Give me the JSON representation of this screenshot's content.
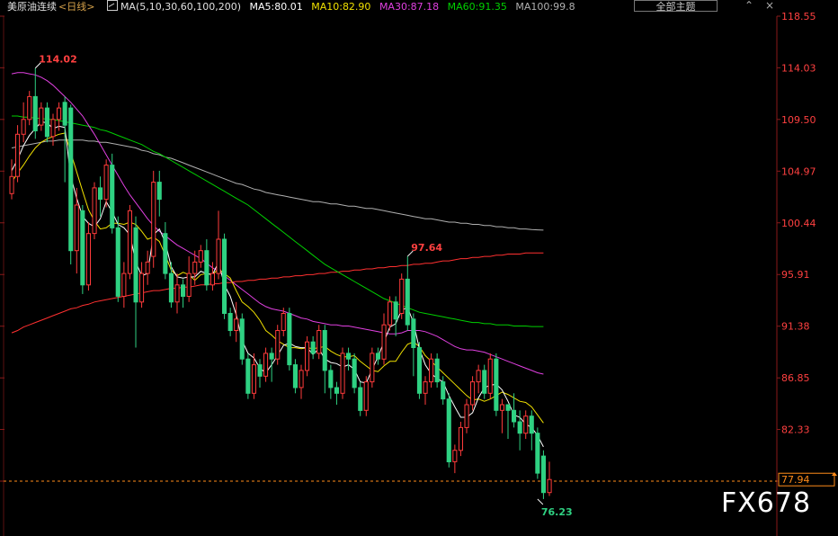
{
  "header": {
    "title": "美原油连续",
    "period": "<日线>",
    "ma_label": "MA(5,10,30,60,100,200)",
    "ma5": "MA5:80.01",
    "ma10": "MA10:82.90",
    "ma30": "MA30:87.18",
    "ma60": "MA60:91.35",
    "ma100": "MA100:99.8"
  },
  "toolbar": {
    "theme_button": "全部主题",
    "icons": [
      "chevron-up-icon",
      "cross-icon"
    ]
  },
  "watermark": "FX678",
  "colors": {
    "background": "#000000",
    "up": "#ff3b3b",
    "down": "#2fd182",
    "ma5": "#ffffff",
    "ma10": "#f0e000",
    "ma30": "#e040e0",
    "ma60": "#00d000",
    "ma100": "#b0b0b0",
    "ma200": "#ff3030",
    "axis_text": "#ff4040",
    "grid": "#5a1010",
    "current_line": "#ff8c1a"
  },
  "chart_data": {
    "type": "candlestick",
    "y_ticks": [
      118.55,
      114.03,
      109.5,
      104.97,
      100.44,
      95.91,
      91.38,
      86.85,
      82.33,
      77.8
    ],
    "ylim": [
      73.5,
      119.5
    ],
    "highest_label": "114.02",
    "mid_high_label": "97.64",
    "lowest_label": "76.23",
    "current_price_label": "77.94",
    "current_price": 77.94,
    "candles": [
      [
        103.0,
        104.5,
        102.5,
        106.0
      ],
      [
        104.5,
        108.2,
        104.0,
        109.0
      ],
      [
        108.2,
        109.5,
        107.5,
        111.0
      ],
      [
        109.5,
        111.5,
        109.0,
        112.0
      ],
      [
        111.5,
        108.5,
        107.8,
        114.0
      ],
      [
        109.0,
        110.5,
        108.5,
        111.0
      ],
      [
        110.5,
        108.0,
        107.5,
        111.0
      ],
      [
        108.0,
        109.5,
        107.2,
        110.0
      ],
      [
        109.5,
        110.5,
        108.5,
        111.0
      ],
      [
        111.0,
        109.0,
        104.0,
        111.5
      ],
      [
        110.5,
        98.0,
        96.8,
        110.8
      ],
      [
        98.0,
        102.0,
        96.0,
        103.5
      ],
      [
        101.5,
        95.0,
        94.2,
        102.0
      ],
      [
        95.0,
        99.5,
        94.5,
        100.5
      ],
      [
        99.5,
        103.5,
        99.0,
        104.0
      ],
      [
        103.5,
        102.5,
        101.0,
        104.5
      ],
      [
        102.5,
        105.5,
        101.8,
        106.0
      ],
      [
        105.5,
        100.0,
        99.5,
        106.5
      ],
      [
        100.0,
        94.0,
        93.5,
        101.0
      ],
      [
        94.0,
        96.0,
        93.0,
        97.0
      ],
      [
        96.0,
        101.5,
        95.5,
        102.0
      ],
      [
        100.0,
        93.5,
        89.5,
        101.0
      ],
      [
        93.5,
        96.0,
        93.0,
        97.0
      ],
      [
        96.0,
        97.0,
        95.0,
        98.0
      ],
      [
        97.5,
        104.0,
        96.5,
        105.0
      ],
      [
        104.0,
        102.5,
        101.0,
        105.0
      ],
      [
        99.5,
        96.0,
        95.5,
        100.5
      ],
      [
        96.0,
        93.5,
        93.0,
        97.0
      ],
      [
        93.5,
        95.0,
        92.5,
        96.0
      ],
      [
        95.0,
        94.0,
        93.0,
        95.5
      ],
      [
        94.0,
        96.0,
        93.5,
        97.5
      ],
      [
        96.0,
        97.0,
        95.0,
        98.0
      ],
      [
        97.0,
        98.0,
        96.5,
        98.5
      ],
      [
        98.0,
        95.0,
        94.5,
        99.0
      ],
      [
        95.0,
        96.0,
        94.5,
        97.0
      ],
      [
        96.0,
        99.0,
        95.5,
        101.5
      ],
      [
        99.0,
        92.5,
        92.0,
        99.5
      ],
      [
        92.5,
        91.0,
        90.5,
        93.0
      ],
      [
        91.0,
        92.0,
        90.0,
        93.5
      ],
      [
        92.0,
        88.5,
        88.0,
        92.5
      ],
      [
        88.5,
        85.5,
        85.0,
        89.0
      ],
      [
        85.5,
        88.0,
        85.0,
        89.0
      ],
      [
        88.0,
        87.0,
        86.0,
        88.5
      ],
      [
        87.0,
        89.0,
        86.5,
        89.5
      ],
      [
        89.0,
        88.5,
        86.5,
        89.5
      ],
      [
        88.5,
        91.0,
        88.0,
        91.5
      ],
      [
        91.0,
        92.5,
        90.5,
        93.0
      ],
      [
        92.5,
        88.0,
        87.5,
        93.0
      ],
      [
        88.0,
        86.0,
        85.5,
        88.5
      ],
      [
        86.0,
        87.5,
        85.0,
        88.0
      ],
      [
        87.5,
        90.0,
        87.0,
        90.5
      ],
      [
        90.0,
        89.0,
        88.5,
        90.5
      ],
      [
        89.0,
        91.0,
        88.5,
        91.5
      ],
      [
        91.0,
        87.5,
        85.5,
        91.5
      ],
      [
        87.5,
        86.0,
        85.0,
        88.0
      ],
      [
        86.0,
        85.5,
        84.5,
        86.5
      ],
      [
        85.5,
        89.0,
        85.0,
        89.5
      ],
      [
        89.0,
        88.5,
        87.5,
        89.5
      ],
      [
        88.5,
        86.0,
        85.5,
        89.0
      ],
      [
        86.0,
        84.0,
        83.5,
        86.5
      ],
      [
        84.0,
        86.5,
        83.5,
        87.0
      ],
      [
        86.5,
        89.0,
        86.0,
        89.5
      ],
      [
        89.0,
        88.5,
        88.0,
        89.5
      ],
      [
        88.5,
        91.5,
        88.0,
        92.5
      ],
      [
        91.5,
        93.5,
        91.0,
        94.0
      ],
      [
        93.5,
        92.0,
        90.5,
        94.0
      ],
      [
        92.5,
        95.5,
        92.0,
        96.0
      ],
      [
        95.5,
        91.5,
        91.0,
        97.5
      ],
      [
        92.0,
        89.5,
        87.0,
        92.5
      ],
      [
        89.5,
        85.5,
        85.0,
        90.0
      ],
      [
        85.5,
        86.5,
        84.5,
        87.0
      ],
      [
        86.5,
        88.5,
        86.0,
        89.0
      ],
      [
        88.5,
        86.5,
        86.0,
        89.0
      ],
      [
        86.5,
        85.0,
        84.5,
        87.0
      ],
      [
        85.0,
        79.5,
        79.0,
        85.5
      ],
      [
        79.5,
        80.5,
        78.5,
        81.0
      ],
      [
        80.5,
        82.5,
        80.0,
        83.0
      ],
      [
        82.5,
        84.5,
        82.0,
        85.0
      ],
      [
        84.5,
        86.5,
        84.0,
        87.0
      ],
      [
        86.5,
        87.5,
        85.5,
        88.0
      ],
      [
        87.5,
        85.5,
        85.0,
        88.0
      ],
      [
        85.5,
        88.5,
        85.0,
        89.0
      ],
      [
        88.5,
        84.0,
        83.5,
        89.0
      ],
      [
        84.0,
        84.5,
        82.0,
        85.0
      ],
      [
        84.5,
        84.0,
        81.5,
        84.5
      ],
      [
        84.0,
        83.0,
        82.5,
        85.5
      ],
      [
        83.0,
        82.0,
        80.5,
        84.0
      ],
      [
        82.0,
        83.5,
        81.5,
        84.0
      ],
      [
        83.5,
        82.0,
        80.5,
        84.0
      ],
      [
        82.0,
        78.5,
        78.0,
        82.5
      ],
      [
        80.0,
        76.8,
        76.23,
        80.5
      ],
      [
        76.8,
        77.94,
        76.5,
        79.5
      ]
    ],
    "ma5": [
      105.0,
      106.0,
      107.2,
      108.1,
      108.7,
      109.3,
      109.2,
      108.7,
      108.9,
      108.8,
      104.5,
      102.6,
      101.0,
      100.4,
      100.1,
      100.8,
      102.3,
      101.4,
      100.3,
      100.0,
      99.4,
      97.0,
      95.8,
      96.0,
      99.4,
      99.9,
      98.7,
      96.6,
      95.7,
      95.6,
      95.7,
      95.7,
      96.2,
      96.0,
      95.9,
      97.0,
      95.0,
      94.0,
      92.4,
      90.1,
      89.0,
      88.6,
      87.7,
      87.3,
      88.0,
      88.8,
      89.7,
      89.9,
      89.6,
      89.5,
      89.5,
      88.9,
      89.4,
      88.5,
      88.2,
      88.1,
      87.8,
      88.0,
      87.6,
      86.5,
      86.4,
      87.6,
      88.7,
      90.0,
      91.3,
      91.6,
      92.8,
      93.0,
      91.7,
      89.4,
      88.0,
      87.2,
      86.8,
      86.5,
      85.3,
      84.3,
      83.4,
      83.4,
      83.8,
      85.1,
      86.0,
      86.2,
      86.3,
      85.8,
      84.8,
      83.6,
      83.4,
      82.8,
      82.5,
      81.8,
      80.8
    ],
    "ma10": [
      104.0,
      104.8,
      105.5,
      106.3,
      107.0,
      107.5,
      107.8,
      108.0,
      108.2,
      108.3,
      106.6,
      104.9,
      103.2,
      101.6,
      100.6,
      99.9,
      100.0,
      100.4,
      100.4,
      100.3,
      100.5,
      100.3,
      99.7,
      99.0,
      99.2,
      98.8,
      97.6,
      96.3,
      95.8,
      96.1,
      95.9,
      95.4,
      95.9,
      96.0,
      95.9,
      96.4,
      96.0,
      95.6,
      94.5,
      93.5,
      93.1,
      92.6,
      91.9,
      91.0,
      90.6,
      90.1,
      89.8,
      89.5,
      89.5,
      89.4,
      89.5,
      89.4,
      89.5,
      89.6,
      89.2,
      88.9,
      88.7,
      88.7,
      88.8,
      88.3,
      87.9,
      87.5,
      87.4,
      87.9,
      88.3,
      88.3,
      89.1,
      89.8,
      90.0,
      89.6,
      88.8,
      88.3,
      87.8,
      87.3,
      86.8,
      86.3,
      85.8,
      85.3,
      84.9,
      85.0,
      84.8,
      85.0,
      85.3,
      85.6,
      85.4,
      85.1,
      84.8,
      84.7,
      84.3,
      83.6,
      82.9
    ],
    "ma30": [
      113.5,
      113.6,
      113.6,
      113.5,
      113.4,
      113.2,
      112.9,
      112.5,
      112.0,
      111.5,
      111.0,
      110.4,
      109.8,
      109.0,
      108.2,
      107.3,
      106.4,
      105.5,
      104.6,
      103.7,
      102.9,
      102.2,
      101.5,
      100.8,
      100.2,
      99.7,
      99.3,
      98.9,
      98.5,
      98.2,
      97.9,
      97.6,
      97.3,
      96.9,
      96.5,
      96.2,
      95.8,
      95.4,
      95.0,
      94.6,
      94.2,
      93.8,
      93.4,
      93.1,
      92.9,
      92.8,
      92.7,
      92.5,
      92.3,
      92.1,
      92.0,
      91.8,
      91.7,
      91.6,
      91.5,
      91.5,
      91.4,
      91.4,
      91.3,
      91.2,
      91.1,
      91.0,
      90.9,
      90.8,
      90.7,
      90.7,
      90.8,
      91.0,
      91.0,
      91.0,
      90.9,
      90.7,
      90.5,
      90.2,
      89.9,
      89.6,
      89.4,
      89.3,
      89.3,
      89.2,
      89.1,
      88.9,
      88.7,
      88.5,
      88.3,
      88.1,
      87.9,
      87.7,
      87.5,
      87.3,
      87.18
    ],
    "ma60": [
      109.8,
      109.8,
      109.7,
      109.7,
      109.6,
      109.6,
      109.5,
      109.5,
      109.4,
      109.3,
      109.2,
      109.1,
      109.0,
      108.9,
      108.8,
      108.6,
      108.5,
      108.3,
      108.1,
      107.9,
      107.7,
      107.5,
      107.3,
      107.0,
      106.7,
      106.5,
      106.2,
      105.9,
      105.6,
      105.3,
      105.0,
      104.7,
      104.4,
      104.1,
      103.8,
      103.5,
      103.2,
      102.9,
      102.6,
      102.3,
      102.0,
      101.6,
      101.2,
      100.8,
      100.4,
      100.0,
      99.6,
      99.2,
      98.8,
      98.4,
      98.0,
      97.6,
      97.2,
      96.8,
      96.5,
      96.2,
      95.9,
      95.6,
      95.3,
      95.0,
      94.7,
      94.4,
      94.1,
      93.8,
      93.6,
      93.4,
      93.2,
      93.0,
      92.8,
      92.6,
      92.5,
      92.4,
      92.3,
      92.2,
      92.1,
      92.0,
      91.9,
      91.8,
      91.7,
      91.7,
      91.6,
      91.6,
      91.5,
      91.5,
      91.5,
      91.4,
      91.4,
      91.4,
      91.35,
      91.35,
      91.35
    ],
    "ma100": [
      107.0,
      107.1,
      107.2,
      107.3,
      107.4,
      107.5,
      107.6,
      107.6,
      107.7,
      107.7,
      107.7,
      107.7,
      107.7,
      107.6,
      107.6,
      107.5,
      107.5,
      107.4,
      107.3,
      107.2,
      107.1,
      107.0,
      106.8,
      106.7,
      106.5,
      106.4,
      106.2,
      106.1,
      105.9,
      105.7,
      105.5,
      105.3,
      105.1,
      104.9,
      104.7,
      104.5,
      104.3,
      104.1,
      103.9,
      103.8,
      103.6,
      103.4,
      103.3,
      103.1,
      103.0,
      102.9,
      102.8,
      102.7,
      102.6,
      102.5,
      102.4,
      102.3,
      102.3,
      102.2,
      102.1,
      102.1,
      102.0,
      101.9,
      101.9,
      101.8,
      101.7,
      101.7,
      101.6,
      101.5,
      101.4,
      101.3,
      101.2,
      101.1,
      101.0,
      100.9,
      100.8,
      100.8,
      100.7,
      100.6,
      100.5,
      100.5,
      100.4,
      100.4,
      100.3,
      100.3,
      100.2,
      100.2,
      100.1,
      100.1,
      100.0,
      100.0,
      99.9,
      99.9,
      99.85,
      99.82,
      99.8
    ],
    "ma200": [
      90.8,
      91.0,
      91.3,
      91.5,
      91.7,
      91.9,
      92.1,
      92.3,
      92.5,
      92.7,
      92.9,
      93.0,
      93.2,
      93.3,
      93.5,
      93.6,
      93.7,
      93.8,
      93.9,
      94.0,
      94.1,
      94.2,
      94.3,
      94.4,
      94.5,
      94.5,
      94.6,
      94.7,
      94.7,
      94.8,
      94.8,
      94.9,
      95.0,
      95.0,
      95.1,
      95.1,
      95.2,
      95.2,
      95.3,
      95.3,
      95.4,
      95.4,
      95.5,
      95.5,
      95.6,
      95.6,
      95.7,
      95.7,
      95.8,
      95.8,
      95.9,
      95.9,
      96.0,
      96.0,
      96.1,
      96.1,
      96.2,
      96.2,
      96.3,
      96.3,
      96.4,
      96.4,
      96.5,
      96.5,
      96.6,
      96.6,
      96.7,
      96.7,
      96.8,
      96.8,
      96.9,
      96.9,
      97.0,
      97.1,
      97.1,
      97.2,
      97.3,
      97.3,
      97.4,
      97.4,
      97.5,
      97.5,
      97.6,
      97.6,
      97.7,
      97.7,
      97.7,
      97.8,
      97.8,
      97.8,
      97.8
    ]
  }
}
